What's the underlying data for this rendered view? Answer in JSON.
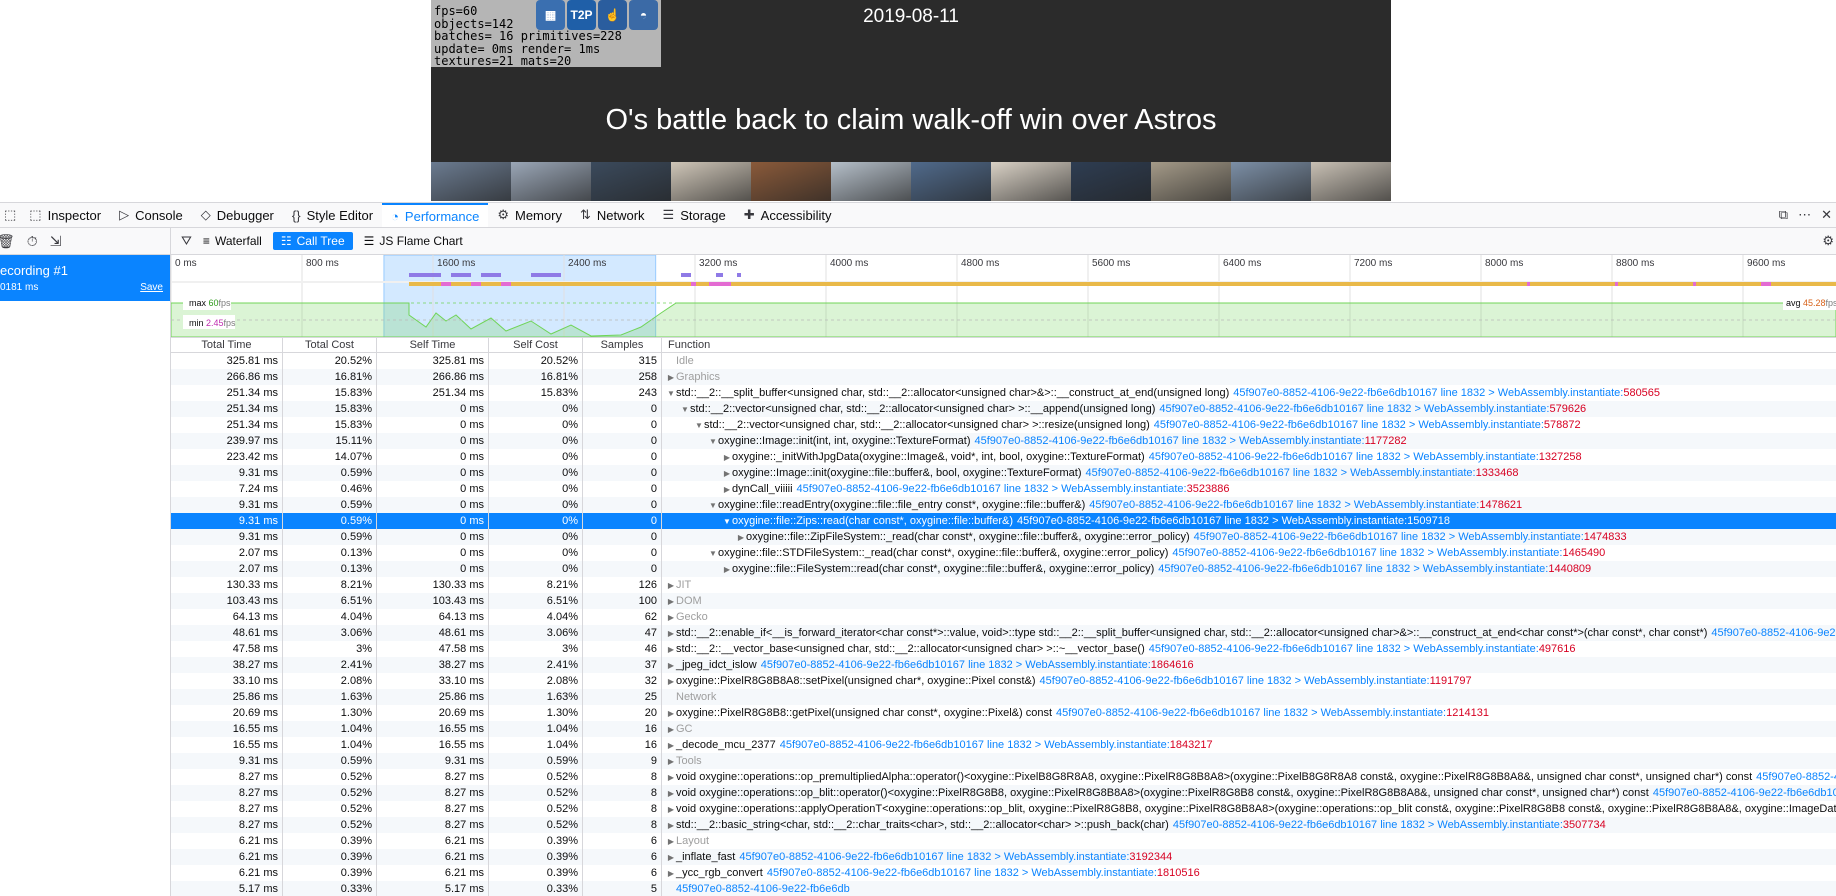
{
  "page": {
    "date": "2019-08-11",
    "headline": "O's battle back to claim walk-off win over Astros",
    "stats": [
      "fps=60",
      "objects=142",
      "batches= 16 primitives=228",
      "update= 0ms render= 1ms",
      "textures=21 mats=20"
    ],
    "stat_icons": [
      {
        "name": "image",
        "label": ""
      },
      {
        "name": "t2p",
        "label": "T2P"
      },
      {
        "name": "touch",
        "label": ""
      },
      {
        "name": "sphere",
        "label": ""
      }
    ],
    "photo_colors": [
      "#6b7b90",
      "#9aa6b6",
      "#3b4a5c",
      "#cfc6b8",
      "#8a5a3a",
      "#b5bfc9",
      "#506a8b",
      "#d9d1c5",
      "#2e3d52",
      "#a49a88",
      "#7c8fa6",
      "#c8c0b4"
    ]
  },
  "toolbox": {
    "tabs": [
      {
        "label": "Inspector",
        "icon": "inspector-icon",
        "glyph": "⬚"
      },
      {
        "label": "Console",
        "icon": "console-icon",
        "glyph": "▷"
      },
      {
        "label": "Debugger",
        "icon": "debugger-icon",
        "glyph": "◇"
      },
      {
        "label": "Style Editor",
        "icon": "style-editor-icon",
        "glyph": "{}"
      },
      {
        "label": "Performance",
        "icon": "performance-icon",
        "glyph": "◔",
        "active": true
      },
      {
        "label": "Memory",
        "icon": "memory-icon",
        "glyph": "⚙"
      },
      {
        "label": "Network",
        "icon": "network-icon",
        "glyph": "⇅"
      },
      {
        "label": "Storage",
        "icon": "storage-icon",
        "glyph": "☰"
      },
      {
        "label": "Accessibility",
        "icon": "accessibility-icon",
        "glyph": "✚"
      }
    ]
  },
  "perf_toolbar": {
    "buttons": [
      {
        "label": "Waterfall",
        "icon": "waterfall-icon",
        "glyph": "≡",
        "selected": false
      },
      {
        "label": "Call Tree",
        "icon": "call-tree-icon",
        "glyph": "☷",
        "selected": true
      },
      {
        "label": "JS Flame Chart",
        "icon": "flame-chart-icon",
        "glyph": "☰",
        "selected": false
      }
    ]
  },
  "recording": {
    "title": "ecording #1",
    "duration": "0181 ms",
    "save": "Save"
  },
  "overview": {
    "ticks": [
      "0 ms",
      "800 ms",
      "1600 ms",
      "2400 ms",
      "3200 ms",
      "4000 ms",
      "4800 ms",
      "5600 ms",
      "6400 ms",
      "7200 ms",
      "8000 ms",
      "8800 ms",
      "9600 ms"
    ],
    "max_label": "max",
    "max_value": "60",
    "min_label": "min",
    "min_value": "2.45",
    "fps_unit": "fps",
    "avg_label": "avg",
    "avg_value": "45.28",
    "selection_start_ms": 1300,
    "selection_end_ms": 2960
  },
  "calltree": {
    "headers": [
      "Total Time",
      "Total Cost",
      "Self Time",
      "Self Cost",
      "Samples",
      "Function"
    ],
    "rows": [
      {
        "tt": "325.81 ms",
        "tc": "20.52%",
        "st": "325.81 ms",
        "sc": "20.52%",
        "sm": "315",
        "indent": 0,
        "tw": "",
        "fn": "Idle",
        "kind": "cat",
        "src": "",
        "addr": ""
      },
      {
        "tt": "266.86 ms",
        "tc": "16.81%",
        "st": "266.86 ms",
        "sc": "16.81%",
        "sm": "258",
        "indent": 0,
        "tw": "▶",
        "fn": "Graphics",
        "kind": "cat",
        "src": "",
        "addr": ""
      },
      {
        "tt": "251.34 ms",
        "tc": "15.83%",
        "st": "251.34 ms",
        "sc": "15.83%",
        "sm": "243",
        "indent": 0,
        "tw": "▼",
        "fn": "std::__2::__split_buffer<unsigned char, std::__2::allocator<unsigned char>&>::__construct_at_end(unsigned long)",
        "kind": "fn",
        "src": "45f907e0-8852-4106-9e22-fb6e6db10167 line 1832 > WebAssembly.instantiate:",
        "addr": "580565"
      },
      {
        "tt": "251.34 ms",
        "tc": "15.83%",
        "st": "0 ms",
        "sc": "0%",
        "sm": "0",
        "indent": 1,
        "tw": "▼",
        "fn": "std::__2::vector<unsigned char, std::__2::allocator<unsigned char> >::__append(unsigned long)",
        "kind": "fn",
        "src": "45f907e0-8852-4106-9e22-fb6e6db10167 line 1832 > WebAssembly.instantiate:",
        "addr": "579626"
      },
      {
        "tt": "251.34 ms",
        "tc": "15.83%",
        "st": "0 ms",
        "sc": "0%",
        "sm": "0",
        "indent": 2,
        "tw": "▼",
        "fn": "std::__2::vector<unsigned char, std::__2::allocator<unsigned char> >::resize(unsigned long)",
        "kind": "fn",
        "src": "45f907e0-8852-4106-9e22-fb6e6db10167 line 1832 > WebAssembly.instantiate:",
        "addr": "578872"
      },
      {
        "tt": "239.97 ms",
        "tc": "15.11%",
        "st": "0 ms",
        "sc": "0%",
        "sm": "0",
        "indent": 3,
        "tw": "▼",
        "fn": "oxygine::Image::init(int, int, oxygine::TextureFormat)",
        "kind": "fn",
        "src": "45f907e0-8852-4106-9e22-fb6e6db10167 line 1832 > WebAssembly.instantiate:",
        "addr": "1177282"
      },
      {
        "tt": "223.42 ms",
        "tc": "14.07%",
        "st": "0 ms",
        "sc": "0%",
        "sm": "0",
        "indent": 4,
        "tw": "▶",
        "fn": "oxygine::_initWithJpgData(oxygine::Image&, void*, int, bool, oxygine::TextureFormat)",
        "kind": "fn",
        "src": "45f907e0-8852-4106-9e22-fb6e6db10167 line 1832 > WebAssembly.instantiate:",
        "addr": "1327258"
      },
      {
        "tt": "9.31 ms",
        "tc": "0.59%",
        "st": "0 ms",
        "sc": "0%",
        "sm": "0",
        "indent": 4,
        "tw": "▶",
        "fn": "oxygine::Image::init(oxygine::file::buffer&, bool, oxygine::TextureFormat)",
        "kind": "fn",
        "src": "45f907e0-8852-4106-9e22-fb6e6db10167 line 1832 > WebAssembly.instantiate:",
        "addr": "1333468"
      },
      {
        "tt": "7.24 ms",
        "tc": "0.46%",
        "st": "0 ms",
        "sc": "0%",
        "sm": "0",
        "indent": 4,
        "tw": "▶",
        "fn": "dynCall_viiiii",
        "kind": "fn",
        "src": "45f907e0-8852-4106-9e22-fb6e6db10167 line 1832 > WebAssembly.instantiate:",
        "addr": "3523886"
      },
      {
        "tt": "9.31 ms",
        "tc": "0.59%",
        "st": "0 ms",
        "sc": "0%",
        "sm": "0",
        "indent": 3,
        "tw": "▼",
        "fn": "oxygine::file::readEntry(oxygine::file::file_entry const*, oxygine::file::buffer&)",
        "kind": "fn",
        "src": "45f907e0-8852-4106-9e22-fb6e6db10167 line 1832 > WebAssembly.instantiate:",
        "addr": "1478621"
      },
      {
        "tt": "9.31 ms",
        "tc": "0.59%",
        "st": "0 ms",
        "sc": "0%",
        "sm": "0",
        "indent": 4,
        "tw": "▼",
        "fn": "oxygine::file::Zips::read(char const*, oxygine::file::buffer&)",
        "kind": "fn",
        "src": "45f907e0-8852-4106-9e22-fb6e6db10167 line 1832 > WebAssembly.instantiate:",
        "addr": "1509718",
        "selected": true
      },
      {
        "tt": "9.31 ms",
        "tc": "0.59%",
        "st": "0 ms",
        "sc": "0%",
        "sm": "0",
        "indent": 5,
        "tw": "▶",
        "fn": "oxygine::file::ZipFileSystem::_read(char const*, oxygine::file::buffer&, oxygine::error_policy)",
        "kind": "fn",
        "src": "45f907e0-8852-4106-9e22-fb6e6db10167 line 1832 > WebAssembly.instantiate:",
        "addr": "1474833"
      },
      {
        "tt": "2.07 ms",
        "tc": "0.13%",
        "st": "0 ms",
        "sc": "0%",
        "sm": "0",
        "indent": 3,
        "tw": "▼",
        "fn": "oxygine::file::STDFileSystem::_read(char const*, oxygine::file::buffer&, oxygine::error_policy)",
        "kind": "fn",
        "src": "45f907e0-8852-4106-9e22-fb6e6db10167 line 1832 > WebAssembly.instantiate:",
        "addr": "1465490"
      },
      {
        "tt": "2.07 ms",
        "tc": "0.13%",
        "st": "0 ms",
        "sc": "0%",
        "sm": "0",
        "indent": 4,
        "tw": "▶",
        "fn": "oxygine::file::FileSystem::read(char const*, oxygine::file::buffer&, oxygine::error_policy)",
        "kind": "fn",
        "src": "45f907e0-8852-4106-9e22-fb6e6db10167 line 1832 > WebAssembly.instantiate:",
        "addr": "1440809"
      },
      {
        "tt": "130.33 ms",
        "tc": "8.21%",
        "st": "130.33 ms",
        "sc": "8.21%",
        "sm": "126",
        "indent": 0,
        "tw": "▶",
        "fn": "JIT",
        "kind": "cat",
        "src": "",
        "addr": ""
      },
      {
        "tt": "103.43 ms",
        "tc": "6.51%",
        "st": "103.43 ms",
        "sc": "6.51%",
        "sm": "100",
        "indent": 0,
        "tw": "▶",
        "fn": "DOM",
        "kind": "cat",
        "src": "",
        "addr": ""
      },
      {
        "tt": "64.13 ms",
        "tc": "4.04%",
        "st": "64.13 ms",
        "sc": "4.04%",
        "sm": "62",
        "indent": 0,
        "tw": "▶",
        "fn": "Gecko",
        "kind": "cat",
        "src": "",
        "addr": ""
      },
      {
        "tt": "48.61 ms",
        "tc": "3.06%",
        "st": "48.61 ms",
        "sc": "3.06%",
        "sm": "47",
        "indent": 0,
        "tw": "▶",
        "fn": "std::__2::enable_if<__is_forward_iterator<char const*>::value, void>::type std::__2::__split_buffer<unsigned char, std::__2::allocator<unsigned char>&>::__construct_at_end<char const*>(char const*, char const*)",
        "kind": "fn",
        "src": "45f907e0-8852-4106-9e22-",
        "addr": ""
      },
      {
        "tt": "47.58 ms",
        "tc": "3%",
        "st": "47.58 ms",
        "sc": "3%",
        "sm": "46",
        "indent": 0,
        "tw": "▶",
        "fn": "std::__2::__vector_base<unsigned char, std::__2::allocator<unsigned char> >::~__vector_base()",
        "kind": "fn",
        "src": "45f907e0-8852-4106-9e22-fb6e6db10167 line 1832 > WebAssembly.instantiate:",
        "addr": "497616"
      },
      {
        "tt": "38.27 ms",
        "tc": "2.41%",
        "st": "38.27 ms",
        "sc": "2.41%",
        "sm": "37",
        "indent": 0,
        "tw": "▶",
        "fn": "_jpeg_idct_islow",
        "kind": "fn",
        "src": "45f907e0-8852-4106-9e22-fb6e6db10167 line 1832 > WebAssembly.instantiate:",
        "addr": "1864616"
      },
      {
        "tt": "33.10 ms",
        "tc": "2.08%",
        "st": "33.10 ms",
        "sc": "2.08%",
        "sm": "32",
        "indent": 0,
        "tw": "▶",
        "fn": "oxygine::PixelR8G8B8A8::setPixel(unsigned char*, oxygine::Pixel const&)",
        "kind": "fn",
        "src": "45f907e0-8852-4106-9e22-fb6e6db10167 line 1832 > WebAssembly.instantiate:",
        "addr": "1191797"
      },
      {
        "tt": "25.86 ms",
        "tc": "1.63%",
        "st": "25.86 ms",
        "sc": "1.63%",
        "sm": "25",
        "indent": 0,
        "tw": "",
        "fn": "Network",
        "kind": "cat",
        "src": "",
        "addr": ""
      },
      {
        "tt": "20.69 ms",
        "tc": "1.30%",
        "st": "20.69 ms",
        "sc": "1.30%",
        "sm": "20",
        "indent": 0,
        "tw": "▶",
        "fn": "oxygine::PixelR8G8B8::getPixel(unsigned char const*, oxygine::Pixel&) const",
        "kind": "fn",
        "src": "45f907e0-8852-4106-9e22-fb6e6db10167 line 1832 > WebAssembly.instantiate:",
        "addr": "1214131"
      },
      {
        "tt": "16.55 ms",
        "tc": "1.04%",
        "st": "16.55 ms",
        "sc": "1.04%",
        "sm": "16",
        "indent": 0,
        "tw": "▶",
        "fn": "GC",
        "kind": "cat",
        "src": "",
        "addr": ""
      },
      {
        "tt": "16.55 ms",
        "tc": "1.04%",
        "st": "16.55 ms",
        "sc": "1.04%",
        "sm": "16",
        "indent": 0,
        "tw": "▶",
        "fn": "_decode_mcu_2377",
        "kind": "fn",
        "src": "45f907e0-8852-4106-9e22-fb6e6db10167 line 1832 > WebAssembly.instantiate:",
        "addr": "1843217"
      },
      {
        "tt": "9.31 ms",
        "tc": "0.59%",
        "st": "9.31 ms",
        "sc": "0.59%",
        "sm": "9",
        "indent": 0,
        "tw": "▶",
        "fn": "Tools",
        "kind": "cat",
        "src": "",
        "addr": ""
      },
      {
        "tt": "8.27 ms",
        "tc": "0.52%",
        "st": "8.27 ms",
        "sc": "0.52%",
        "sm": "8",
        "indent": 0,
        "tw": "▶",
        "fn": "void oxygine::operations::op_premultipliedAlpha::operator()<oxygine::PixelB8G8R8A8, oxygine::PixelR8G8B8A8>(oxygine::PixelB8G8R8A8 const&, oxygine::PixelR8G8B8A8&, unsigned char const*, unsigned char*) const",
        "kind": "fn",
        "src": "45f907e0-8852-4",
        "addr": ""
      },
      {
        "tt": "8.27 ms",
        "tc": "0.52%",
        "st": "8.27 ms",
        "sc": "0.52%",
        "sm": "8",
        "indent": 0,
        "tw": "▶",
        "fn": "void oxygine::operations::op_blit::operator()<oxygine::PixelR8G8B8, oxygine::PixelR8G8B8A8>(oxygine::PixelR8G8B8 const&, oxygine::PixelR8G8B8A8&, unsigned char const*, unsigned char*) const",
        "kind": "fn",
        "src": "45f907e0-8852-4106-9e22-fb6e6db101",
        "addr": ""
      },
      {
        "tt": "8.27 ms",
        "tc": "0.52%",
        "st": "8.27 ms",
        "sc": "0.52%",
        "sm": "8",
        "indent": 0,
        "tw": "▶",
        "fn": "void oxygine::operations::applyOperationT<oxygine::operations::op_blit, oxygine::PixelR8G8B8, oxygine::PixelR8G8B8A8>(oxygine::operations::op_blit const&, oxygine::PixelR8G8B8 const&, oxygine::PixelR8G8B8A8&, oxygine::ImageDat",
        "kind": "fn",
        "src": "",
        "addr": ""
      },
      {
        "tt": "8.27 ms",
        "tc": "0.52%",
        "st": "8.27 ms",
        "sc": "0.52%",
        "sm": "8",
        "indent": 0,
        "tw": "▶",
        "fn": "std::__2::basic_string<char, std::__2::char_traits<char>, std::__2::allocator<char> >::push_back(char)",
        "kind": "fn",
        "src": "45f907e0-8852-4106-9e22-fb6e6db10167 line 1832 > WebAssembly.instantiate:",
        "addr": "3507734"
      },
      {
        "tt": "6.21 ms",
        "tc": "0.39%",
        "st": "6.21 ms",
        "sc": "0.39%",
        "sm": "6",
        "indent": 0,
        "tw": "▶",
        "fn": "Layout",
        "kind": "cat",
        "src": "",
        "addr": ""
      },
      {
        "tt": "6.21 ms",
        "tc": "0.39%",
        "st": "6.21 ms",
        "sc": "0.39%",
        "sm": "6",
        "indent": 0,
        "tw": "▶",
        "fn": "_inflate_fast",
        "kind": "fn",
        "src": "45f907e0-8852-4106-9e22-fb6e6db10167 line 1832 > WebAssembly.instantiate:",
        "addr": "3192344"
      },
      {
        "tt": "6.21 ms",
        "tc": "0.39%",
        "st": "6.21 ms",
        "sc": "0.39%",
        "sm": "6",
        "indent": 0,
        "tw": "▶",
        "fn": "_ycc_rgb_convert",
        "kind": "fn",
        "src": "45f907e0-8852-4106-9e22-fb6e6db10167 line 1832 > WebAssembly.instantiate:",
        "addr": "1810516"
      },
      {
        "tt": "5.17 ms",
        "tc": "0.33%",
        "st": "5.17 ms",
        "sc": "0.33%",
        "sm": "5",
        "indent": 0,
        "tw": "",
        "fn": "",
        "kind": "fn",
        "src": "45f907e0-8852-4106-9e22-fb6e6db",
        "addr": ""
      }
    ]
  }
}
